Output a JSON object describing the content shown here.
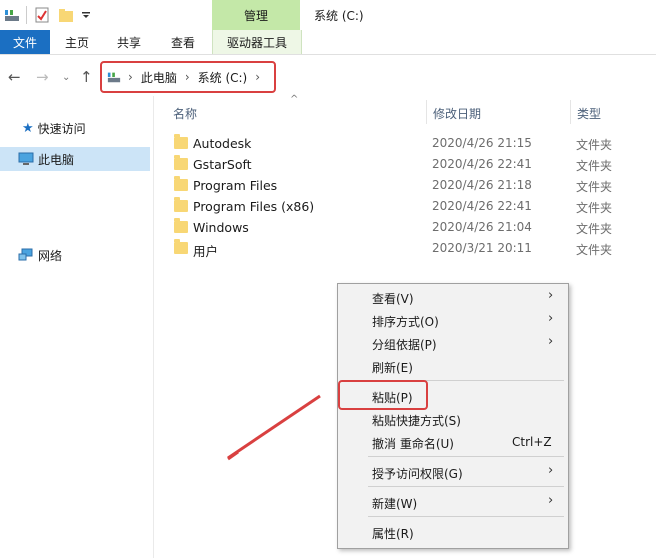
{
  "window": {
    "title": "系统 (C:)",
    "contextual_tab_header": "管理"
  },
  "ribbon": {
    "tabs": [
      "文件",
      "主页",
      "共享",
      "查看",
      "驱动器工具"
    ]
  },
  "address": {
    "segments": [
      "此电脑",
      "系统 (C:)"
    ],
    "separator": "›"
  },
  "nav_pane": {
    "items": [
      "快速访问",
      "此电脑",
      "网络"
    ],
    "selected": "此电脑"
  },
  "columns": {
    "name": "名称",
    "date": "修改日期",
    "type": "类型"
  },
  "files": [
    {
      "name": "Autodesk",
      "date": "2020/4/26 21:15",
      "type": "文件夹"
    },
    {
      "name": "GstarSoft",
      "date": "2020/4/26 22:41",
      "type": "文件夹"
    },
    {
      "name": "Program Files",
      "date": "2020/4/26 21:18",
      "type": "文件夹"
    },
    {
      "name": "Program Files (x86)",
      "date": "2020/4/26 22:41",
      "type": "文件夹"
    },
    {
      "name": "Windows",
      "date": "2020/4/26 21:04",
      "type": "文件夹"
    },
    {
      "name": "用户",
      "date": "2020/3/21 20:11",
      "type": "文件夹"
    }
  ],
  "context_menu": {
    "items": [
      {
        "label": "查看(V)",
        "submenu": true
      },
      {
        "label": "排序方式(O)",
        "submenu": true
      },
      {
        "label": "分组依据(P)",
        "submenu": true
      },
      {
        "label": "刷新(E)"
      },
      {
        "label": "粘贴(P)"
      },
      {
        "label": "粘贴快捷方式(S)"
      },
      {
        "label": "撤消 重命名(U)",
        "shortcut": "Ctrl+Z"
      },
      {
        "label": "授予访问权限(G)",
        "submenu": true
      },
      {
        "label": "新建(W)",
        "submenu": true
      },
      {
        "label": "属性(R)"
      }
    ]
  },
  "colors": {
    "highlight_red": "#d94040",
    "file_tab_blue": "#1b6fc2",
    "manage_green": "#c4e8a8",
    "folder_yellow": "#f8d775"
  },
  "icons": {
    "back": "arrow-left-icon",
    "forward": "arrow-right-icon",
    "up": "arrow-up-icon",
    "submenu": "chevron-right-icon"
  }
}
